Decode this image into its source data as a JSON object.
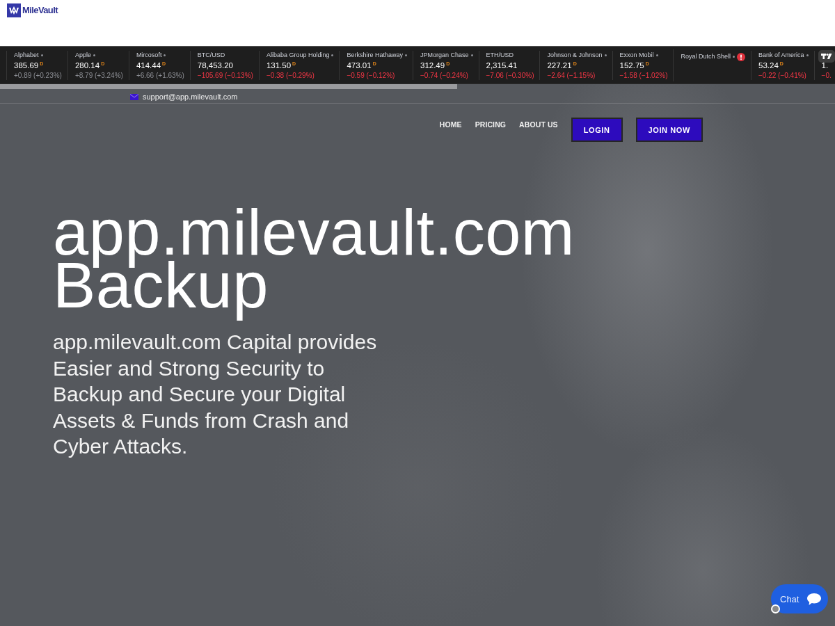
{
  "logo": {
    "text": "MileVault"
  },
  "ticker": {
    "items": [
      {
        "kind": "quote",
        "name": "Alphabet",
        "dot": true,
        "price": "385.69",
        "suffix": "D",
        "change": "+0.89 (+0.23%)",
        "negative": false
      },
      {
        "kind": "quote",
        "name": "Apple",
        "dot": true,
        "price": "280.14",
        "suffix": "D",
        "change": "+8.79 (+3.24%)",
        "negative": false
      },
      {
        "kind": "quote",
        "name": "Mircosoft",
        "dot": true,
        "price": "414.44",
        "suffix": "D",
        "change": "+6.66 (+1.63%)",
        "negative": false
      },
      {
        "kind": "quote",
        "name": "BTC/USD",
        "dot": false,
        "price": "78,453.20",
        "change": "−105.69 (−0.13%)",
        "negative": true
      },
      {
        "kind": "quote",
        "name": "Alibaba Group Holding",
        "dot": true,
        "price": "131.50",
        "suffix": "D",
        "change": "−0.38 (−0.29%)",
        "negative": true
      },
      {
        "kind": "quote",
        "name": "Berkshire Hathaway",
        "dot": true,
        "price": "473.01",
        "suffix": "D",
        "change": "−0.59 (−0.12%)",
        "negative": true
      },
      {
        "kind": "quote",
        "name": "JPMorgan Chase",
        "dot": true,
        "price": "312.49",
        "suffix": "D",
        "change": "−0.74 (−0.24%)",
        "negative": true
      },
      {
        "kind": "quote",
        "name": "ETH/USD",
        "dot": false,
        "price": "2,315.41",
        "change": "−7.06 (−0.30%)",
        "negative": true
      },
      {
        "kind": "quote",
        "name": "Johnson & Johnson",
        "dot": true,
        "price": "227.21",
        "suffix": "D",
        "change": "−2.64 (−1.15%)",
        "negative": true
      },
      {
        "kind": "quote",
        "name": "Exxon Mobil",
        "dot": true,
        "price": "152.75",
        "suffix": "D",
        "change": "−1.58 (−1.02%)",
        "negative": true
      },
      {
        "kind": "error",
        "name": "Royal Dutch Shell",
        "dot": true
      },
      {
        "kind": "quote",
        "name": "Bank of America",
        "dot": true,
        "price": "53.24",
        "suffix": "D",
        "change": "−0.22 (−0.41%)",
        "negative": true
      },
      {
        "kind": "quote",
        "price": "1.",
        "change": "−0.",
        "negative": true
      }
    ]
  },
  "contact": {
    "email": "support@app.milevault.com"
  },
  "nav": {
    "links": [
      "HOME",
      "PRICING",
      "ABOUT US"
    ],
    "buttons": [
      "LOGIN",
      "JOIN NOW"
    ]
  },
  "hero": {
    "title": "app.milevault.com Backup",
    "text": "app.milevault.com Capital provides Easier and Strong Security to Backup and Secure your Digital Assets & Funds from Crash and Cyber Attacks."
  },
  "chat": {
    "label": "Chat"
  }
}
